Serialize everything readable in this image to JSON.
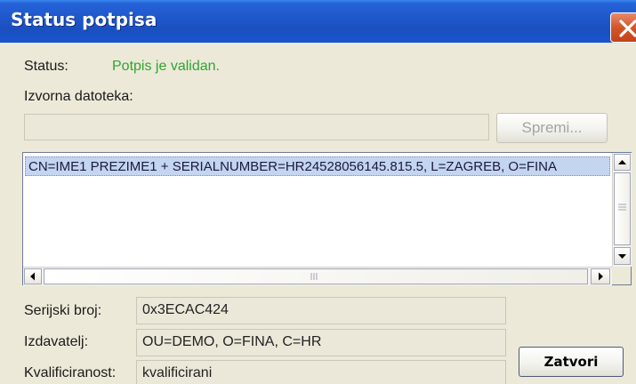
{
  "window": {
    "title": "Status potpisa"
  },
  "status": {
    "label": "Status:",
    "value": "Potpis je validan."
  },
  "source_file": {
    "label": "Izvorna datoteka:",
    "value": "",
    "save_button": "Spremi..."
  },
  "certificates": {
    "items": [
      "CN=IME1 PREZIME1 + SERIALNUMBER=HR24528056145.815.5, L=ZAGREB, O=FINA"
    ]
  },
  "details": {
    "serial": {
      "label": "Serijski broj:",
      "value": "0x3ECAC424"
    },
    "issuer": {
      "label": "Izdavatelj:",
      "value": "OU=DEMO, O=FINA, C=HR"
    },
    "qualification": {
      "label": "Kvalificiranost:",
      "value": "kvalificirani"
    }
  },
  "close_button": "Zatvori",
  "colors": {
    "title_bar": "#1b4fc0",
    "status_ok": "#2fa52f",
    "background": "#ece9d8"
  }
}
